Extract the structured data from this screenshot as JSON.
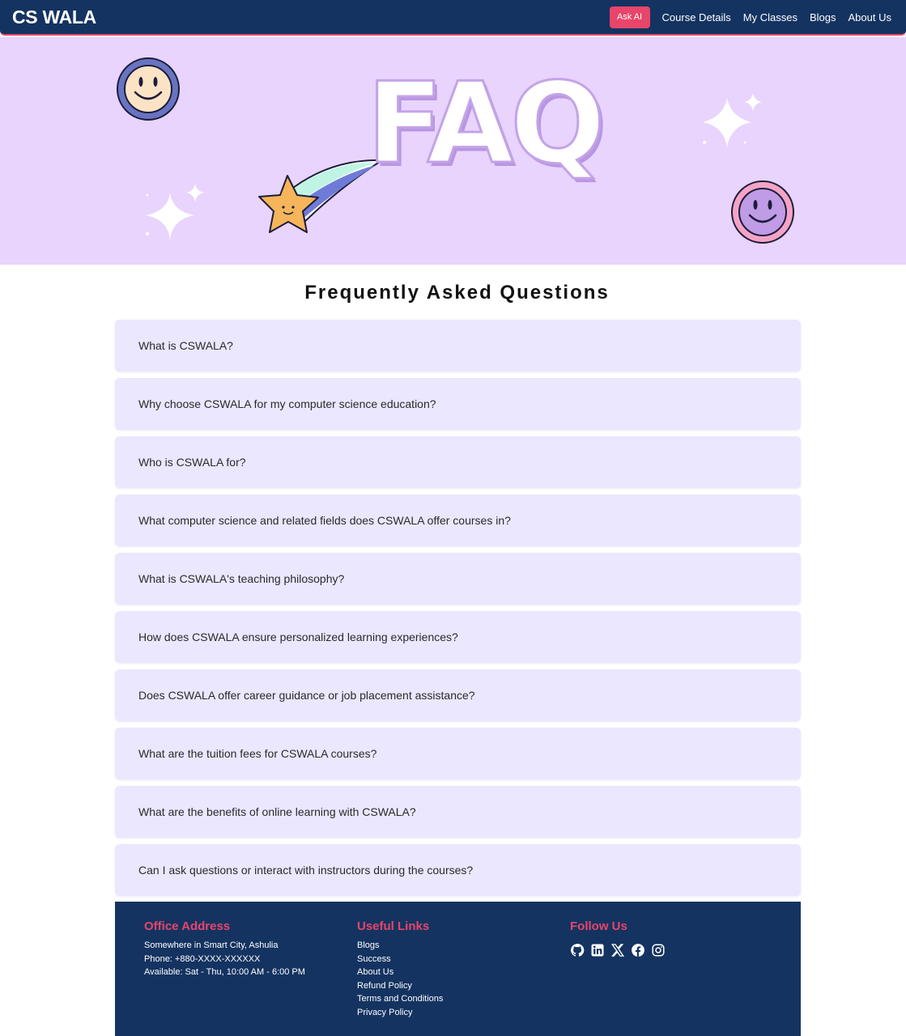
{
  "navbar": {
    "brand": "CS WALA",
    "ask_ai": "Ask AI",
    "links": [
      "Course Details",
      "My Classes",
      "Blogs",
      "About Us"
    ]
  },
  "hero": {
    "banner_text": "FAQ"
  },
  "faq": {
    "title": "Frequently Asked Questions",
    "questions": [
      "What is CSWALA?",
      "Why choose CSWALA for my computer science education?",
      "Who is CSWALA for?",
      "What computer science and related fields does CSWALA offer courses in?",
      "What is CSWALA's teaching philosophy?",
      "How does CSWALA ensure personalized learning experiences?",
      "Does CSWALA offer career guidance or job placement assistance?",
      "What are the tuition fees for CSWALA courses?",
      "What are the benefits of online learning with CSWALA?",
      "Can I ask questions or interact with instructors during the courses?"
    ]
  },
  "footer": {
    "office": {
      "heading": "Office Address",
      "lines": [
        "Somewhere in Smart City, Ashulia",
        "Phone: +880-XXXX-XXXXXX",
        "Available: Sat - Thu, 10:00 AM - 6:00 PM"
      ]
    },
    "useful_links": {
      "heading": "Useful Links",
      "links": [
        "Blogs",
        "Success",
        "About Us",
        "Refund Policy",
        "Terms and Conditions",
        "Privacy Policy"
      ]
    },
    "follow": {
      "heading": "Follow Us",
      "icons": [
        "github-icon",
        "linkedin-icon",
        "x-icon",
        "facebook-icon",
        "instagram-icon"
      ]
    }
  },
  "colors": {
    "navy": "#143361",
    "accent": "#e8456a",
    "hero_bg": "#e8d4fd",
    "faq_item_bg": "#ebe7ff"
  }
}
